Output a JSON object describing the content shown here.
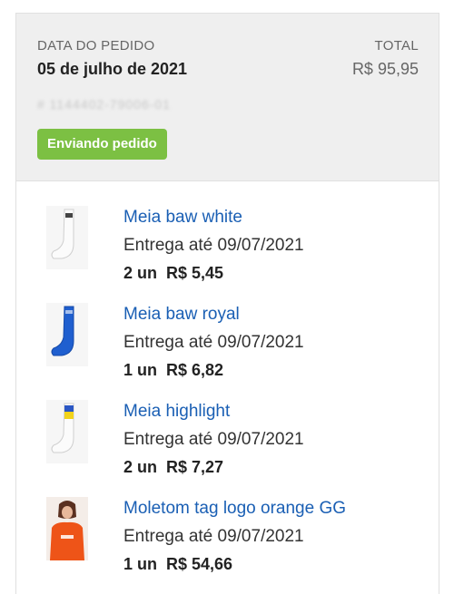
{
  "order": {
    "date_label": "DATA DO PEDIDO",
    "date": "05 de julho de 2021",
    "total_label": "TOTAL",
    "total": "R$ 95,95",
    "number": "# 1144402-79006-01",
    "status": "Enviando pedido",
    "status_color": "#7cc043"
  },
  "items": [
    {
      "name": "Meia baw white",
      "delivery": "Entrega até 09/07/2021",
      "qty": "2 un",
      "price": "R$ 5,45",
      "image": "white-sock-thumbnail"
    },
    {
      "name": "Meia baw royal",
      "delivery": "Entrega até 09/07/2021",
      "qty": "1 un",
      "price": "R$ 6,82",
      "image": "blue-sock-thumbnail"
    },
    {
      "name": "Meia highlight",
      "delivery": "Entrega até 09/07/2021",
      "qty": "2 un",
      "price": "R$ 7,27",
      "image": "yellow-blue-sock-thumbnail"
    },
    {
      "name": "Moletom tag logo orange GG",
      "delivery": "Entrega até 09/07/2021",
      "qty": "1 un",
      "price": "R$ 54,66",
      "image": "orange-hoodie-thumbnail"
    }
  ],
  "colors": {
    "link": "#1a5fb4",
    "header_bg": "#efefef"
  }
}
